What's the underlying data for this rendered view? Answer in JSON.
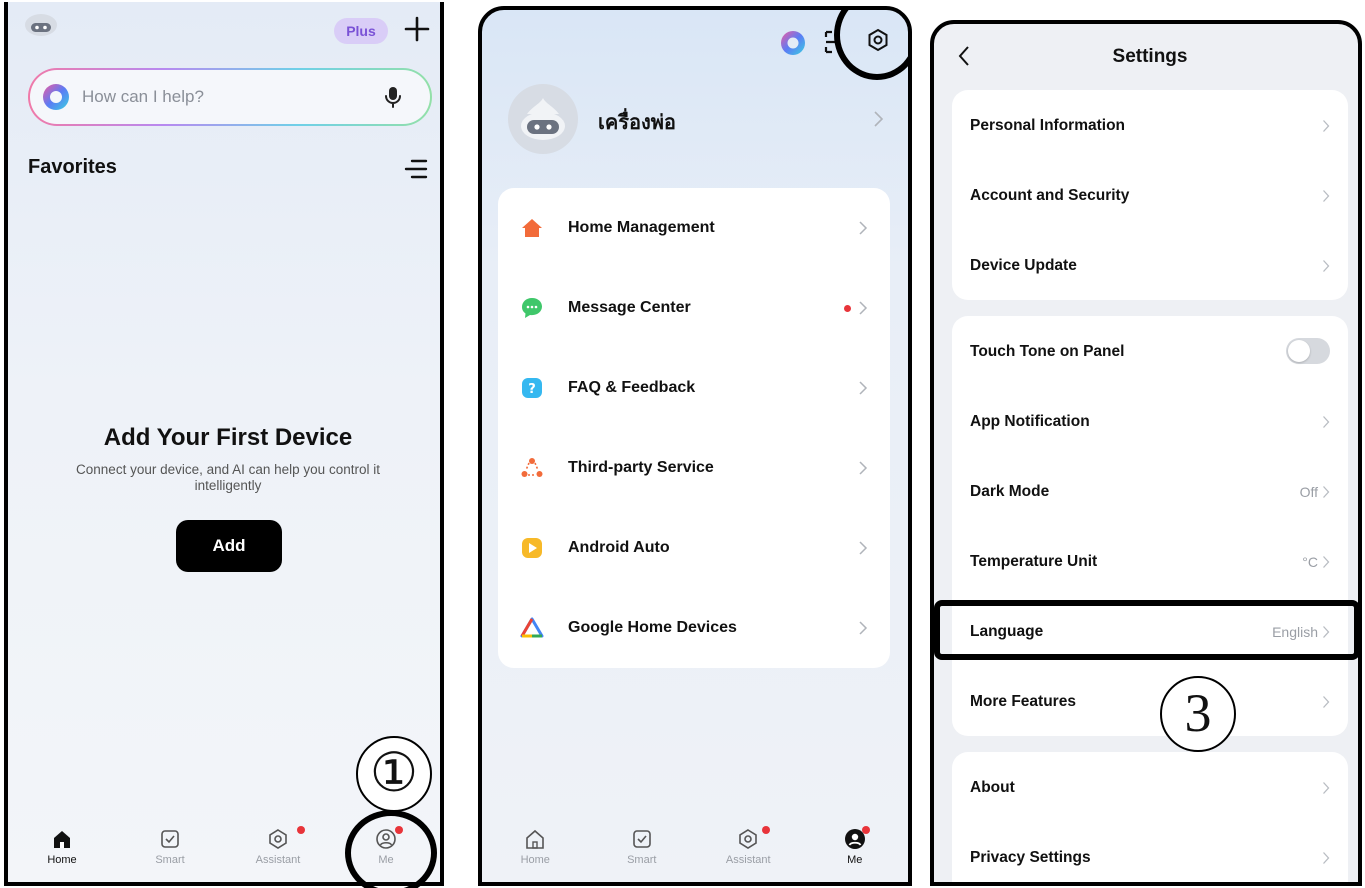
{
  "home_screen": {
    "plus_badge": "Plus",
    "search_placeholder": "How can I help?",
    "favorites_title": "Favorites",
    "empty_title": "Add Your First Device",
    "empty_desc": "Connect your device, and AI can help you control it intelligently",
    "add_button": "Add",
    "tabs": [
      {
        "label": "Home",
        "icon": "home-icon",
        "active": true
      },
      {
        "label": "Smart",
        "icon": "checkbox-icon",
        "active": false
      },
      {
        "label": "Assistant",
        "icon": "assistant-icon",
        "active": false
      },
      {
        "label": "Me",
        "icon": "user-icon",
        "active": false
      }
    ],
    "step_number": "①"
  },
  "me_screen": {
    "profile_name": "เครื่องพ่อ",
    "menu": [
      {
        "label": "Home Management",
        "icon": "home-icon",
        "color": "#f26b3a"
      },
      {
        "label": "Message Center",
        "icon": "chat-bubble-icon",
        "color": "#3fc76a",
        "has_dot": true
      },
      {
        "label": "FAQ & Feedback",
        "icon": "question-icon",
        "color": "#35b8f0"
      },
      {
        "label": "Third-party Service",
        "icon": "third-party-icon",
        "color": "#f26b3a"
      },
      {
        "label": "Android Auto",
        "icon": "android-auto-icon",
        "color": "#f7b928"
      },
      {
        "label": "Google Home Devices",
        "icon": "google-home-icon",
        "color": "#4285f4"
      }
    ],
    "tabs": [
      {
        "label": "Home",
        "icon": "home-icon",
        "active": false
      },
      {
        "label": "Smart",
        "icon": "checkbox-icon",
        "active": false
      },
      {
        "label": "Assistant",
        "icon": "assistant-icon",
        "active": false
      },
      {
        "label": "Me",
        "icon": "user-icon",
        "active": true
      }
    ]
  },
  "settings_screen": {
    "title": "Settings",
    "group1": [
      {
        "label": "Personal Information"
      },
      {
        "label": "Account and Security"
      },
      {
        "label": "Device Update"
      }
    ],
    "group2": [
      {
        "label": "Touch Tone on Panel",
        "toggle": false
      },
      {
        "label": "App Notification"
      },
      {
        "label": "Dark Mode",
        "value": "Off"
      },
      {
        "label": "Temperature Unit",
        "value": "°C"
      },
      {
        "label": "Language",
        "value": "English"
      },
      {
        "label": "More Features"
      }
    ],
    "group3": [
      {
        "label": "About"
      },
      {
        "label": "Privacy Settings"
      }
    ],
    "step_number": "3"
  },
  "colors": {
    "accent_purple": "#7a52d6",
    "dot_red": "#e8343a"
  }
}
